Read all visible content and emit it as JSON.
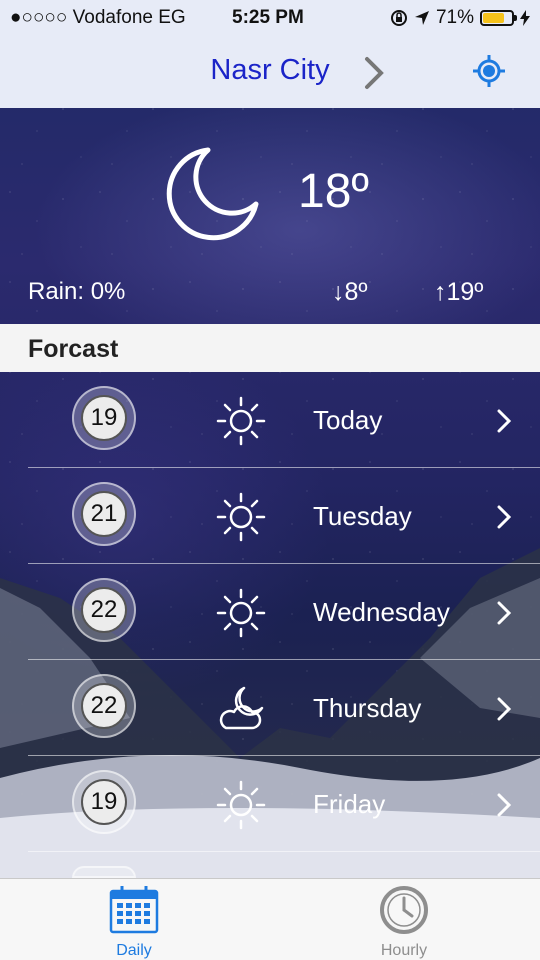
{
  "status": {
    "carrier": "●○○○○ Vodafone EG",
    "time": "5:25 PM",
    "battery": "71%"
  },
  "header": {
    "city": "Nasr City",
    "accent": "#1b24c8",
    "location_color": "#1e7be0"
  },
  "current": {
    "temp": "18º",
    "rain": "Rain: 0%",
    "low": "↓8º",
    "high": "↑19º",
    "icon": "moon-icon"
  },
  "forecast": {
    "title": "Forcast",
    "days": [
      {
        "day": "Today",
        "temp": "19",
        "icon": "sun-icon"
      },
      {
        "day": "Tuesday",
        "temp": "21",
        "icon": "sun-icon"
      },
      {
        "day": "Wednesday",
        "temp": "22",
        "icon": "sun-icon"
      },
      {
        "day": "Thursday",
        "temp": "22",
        "icon": "partly-cloudy-night-icon"
      },
      {
        "day": "Friday",
        "temp": "19",
        "icon": "sun-icon"
      }
    ]
  },
  "tabs": {
    "daily": "Daily",
    "hourly": "Hourly",
    "active_color": "#1e7be0",
    "inactive_color": "#8e8e8e"
  }
}
